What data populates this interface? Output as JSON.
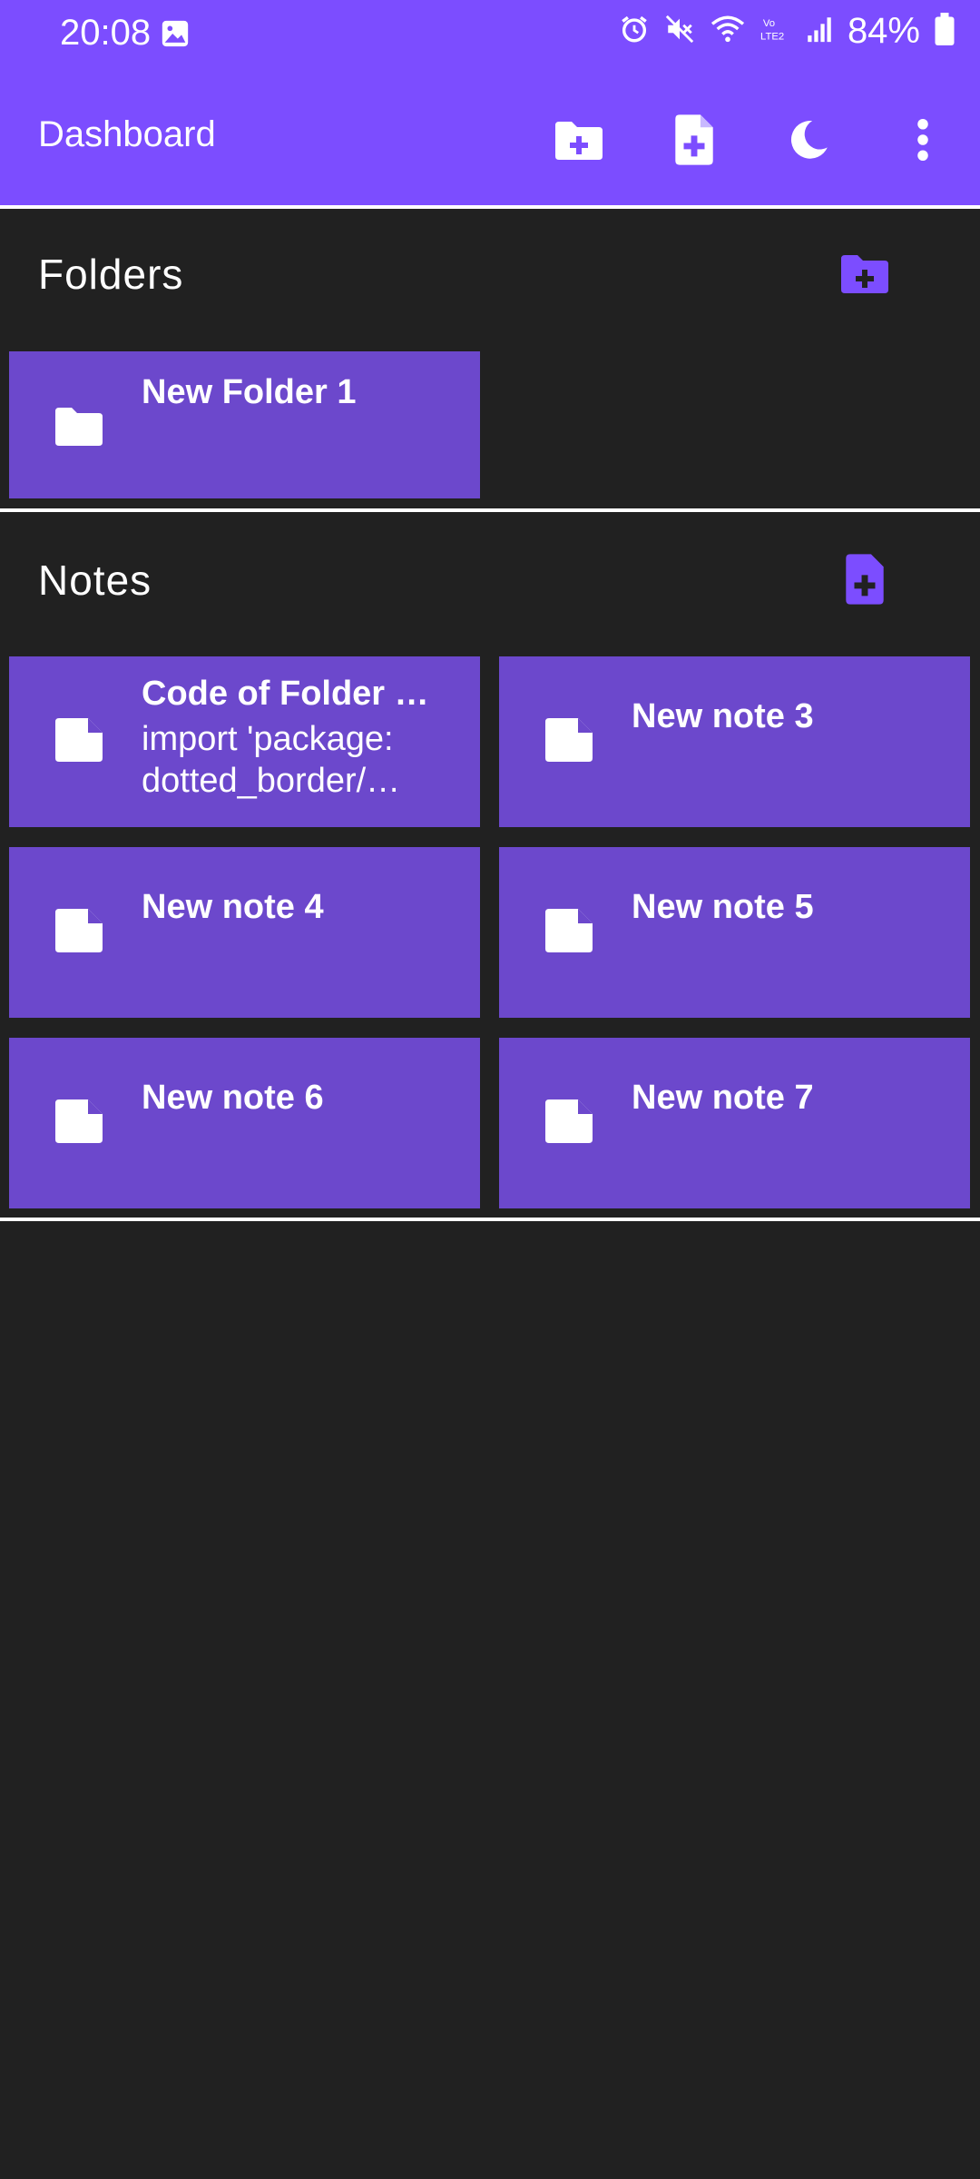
{
  "status_bar": {
    "time": "20:08",
    "battery": "84%",
    "icons": [
      "gallery-icon",
      "alarm-icon",
      "mute-icon",
      "wifi-icon",
      "volte-icon",
      "signal-icon",
      "battery-icon"
    ]
  },
  "app_bar": {
    "title": "Dashboard",
    "actions": [
      "create-folder-icon",
      "create-note-icon",
      "dark-mode-icon",
      "more-options-icon"
    ]
  },
  "folders": {
    "title": "Folders",
    "items": [
      {
        "name": "New Folder 1"
      }
    ]
  },
  "notes": {
    "title": "Notes",
    "items": [
      {
        "title": "Code of Folder …",
        "preview_line1": "import 'package:",
        "preview_line2": "dotted_border/…"
      },
      {
        "title": "New note 3"
      },
      {
        "title": "New note 4"
      },
      {
        "title": "New note 5"
      },
      {
        "title": "New note 6"
      },
      {
        "title": "New note 7"
      }
    ]
  },
  "colors": {
    "accent": "#7c4dff",
    "tile": "#6c48cc",
    "background": "#212121",
    "divider": "#ffffff"
  }
}
